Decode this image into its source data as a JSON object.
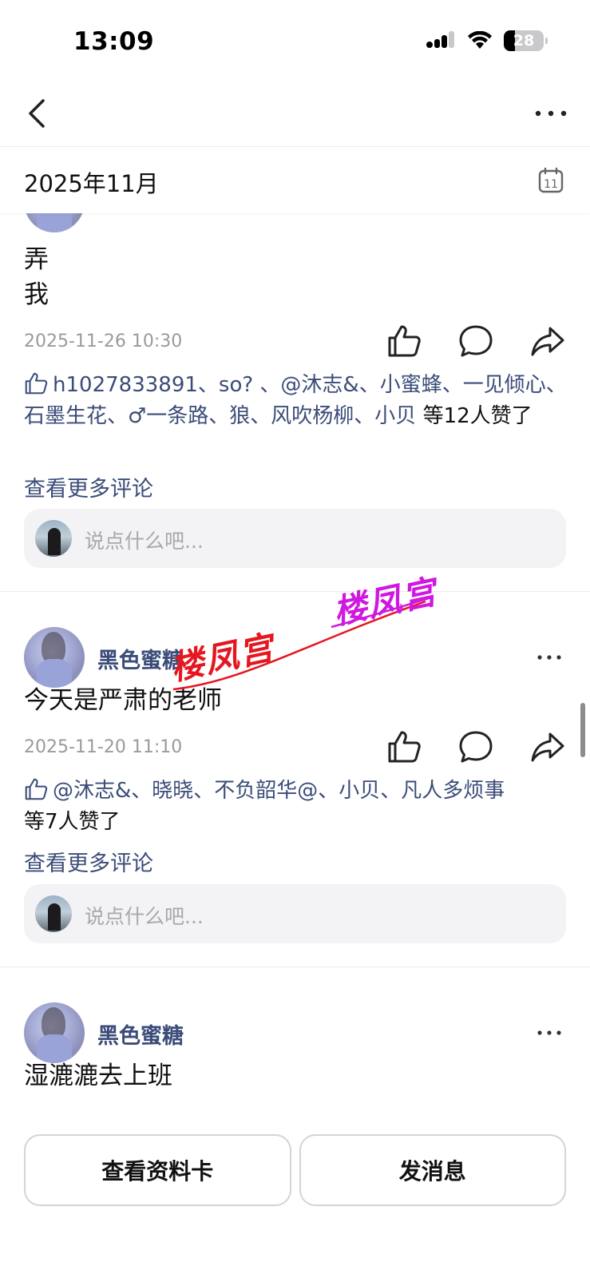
{
  "status_bar": {
    "time": "13:09",
    "battery": "28"
  },
  "nav": {
    "back_icon": "chevron-left-icon",
    "more_icon": "ellipsis-icon"
  },
  "date_header": {
    "label": "2025年11月",
    "calendar_icon": "calendar-icon",
    "calendar_day": "11"
  },
  "posts": [
    {
      "text_lines": [
        "弄",
        "我"
      ],
      "time": "2025-11-26 10:30",
      "likes_names": "h1027833891、so? 、@沐志&、小蜜蜂、一见倾心、石墨生花、♂一条路、狼、风吹杨柳、小贝",
      "likes_suffix": " 等12人赞了",
      "more_comments": "查看更多评论",
      "comment_placeholder": "说点什么吧..."
    },
    {
      "username": "黑色蜜糖",
      "text": "今天是严肃的老师",
      "time": "2025-11-20 11:10",
      "likes_names": "@沐志&、晓晓、不负韶华@、小贝、凡人多烦事",
      "likes_suffix": "等7人赞了",
      "more_comments": "查看更多评论",
      "comment_placeholder": "说点什么吧..."
    },
    {
      "username": "黑色蜜糖",
      "text": "湿漉漉去上班"
    }
  ],
  "watermark": {
    "text_red": "楼凤宫",
    "text_purple": "楼凤宫",
    "red": "#e5161f",
    "purple": "#cf18e0"
  },
  "bottom_actions": {
    "profile_card": "查看资料卡",
    "send_message": "发消息"
  },
  "colors": {
    "link": "#3b4c78",
    "muted": "#9a9a9f",
    "input_bg": "#f3f3f5"
  }
}
